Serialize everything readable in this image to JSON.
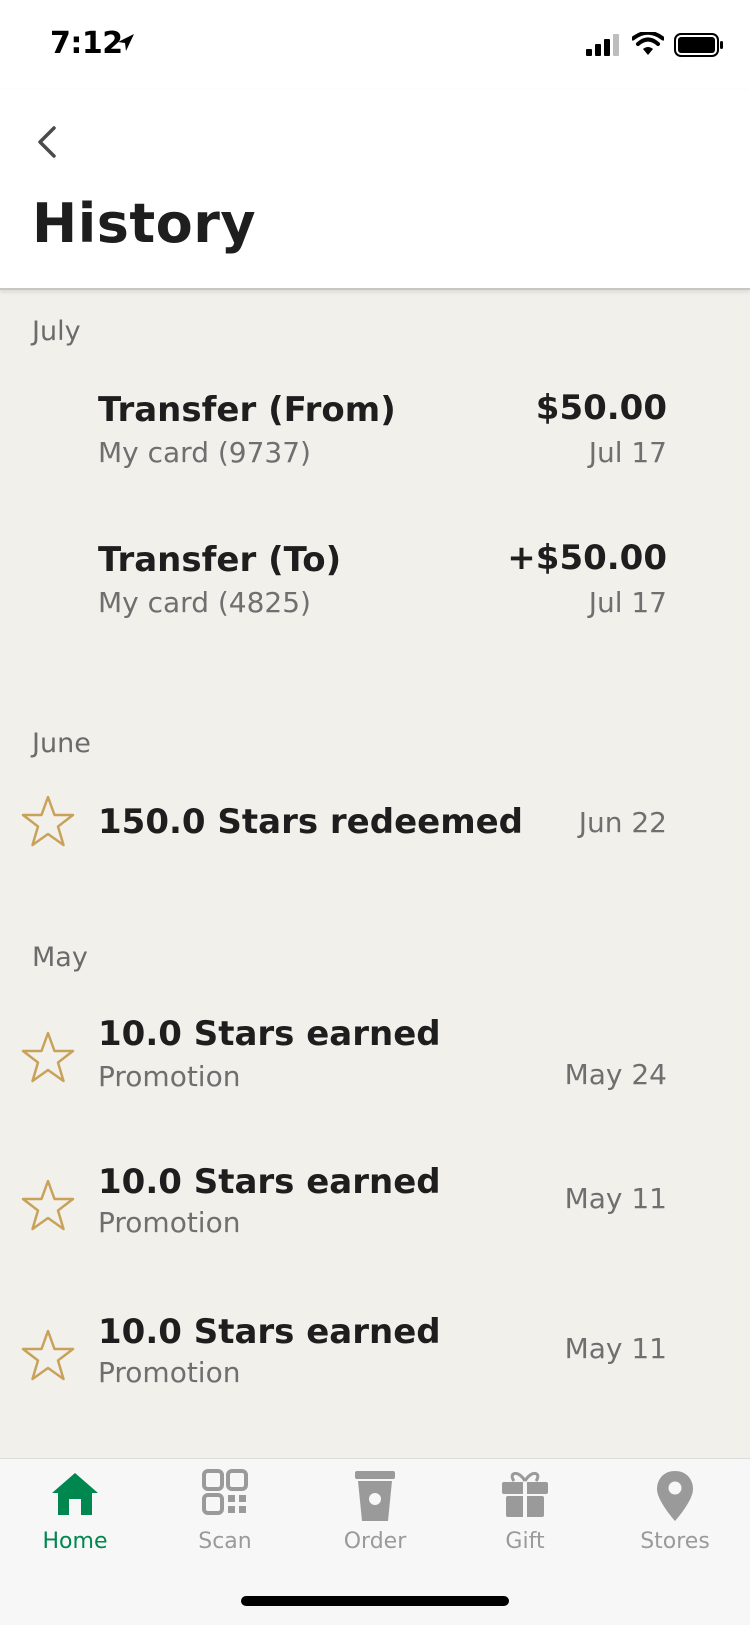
{
  "status_bar": {
    "time": "7:12",
    "icons": [
      "location-arrow-icon",
      "signal-icon",
      "wifi-icon",
      "battery-icon"
    ]
  },
  "header": {
    "back_icon": "chevron-left-icon",
    "title": "History"
  },
  "sections": [
    {
      "month": "July",
      "items": [
        {
          "title": "Transfer (From)",
          "subtitle": "My card (9737)",
          "amount": "$50.00",
          "date": "Jul 17"
        },
        {
          "title": "Transfer (To)",
          "subtitle": "My card (4825)",
          "amount": "+$50.00",
          "date": "Jul 17"
        }
      ]
    },
    {
      "month": "June",
      "items": [
        {
          "title": "150.0 Stars redeemed",
          "date": "Jun 22",
          "icon": "star-icon"
        }
      ]
    },
    {
      "month": "May",
      "items": [
        {
          "title": "10.0 Stars earned",
          "subtitle": "Promotion",
          "date": "May 24",
          "icon": "star-icon"
        },
        {
          "title": "10.0 Stars earned",
          "subtitle": "Promotion",
          "date": "May 11",
          "icon": "star-icon"
        },
        {
          "title": "10.0 Stars earned",
          "subtitle": "Promotion",
          "date": "May 11",
          "icon": "star-icon"
        }
      ]
    }
  ],
  "tabbar": {
    "tabs": [
      {
        "label": "Home",
        "icon": "home-icon",
        "active": true
      },
      {
        "label": "Scan",
        "icon": "qr-code-icon",
        "active": false
      },
      {
        "label": "Order",
        "icon": "cup-icon",
        "active": false
      },
      {
        "label": "Gift",
        "icon": "gift-icon",
        "active": false
      },
      {
        "label": "Stores",
        "icon": "map-pin-icon",
        "active": false
      }
    ]
  },
  "colors": {
    "accent": "#00874f",
    "star": "#c8a25a",
    "background": "#f2f0eb"
  }
}
